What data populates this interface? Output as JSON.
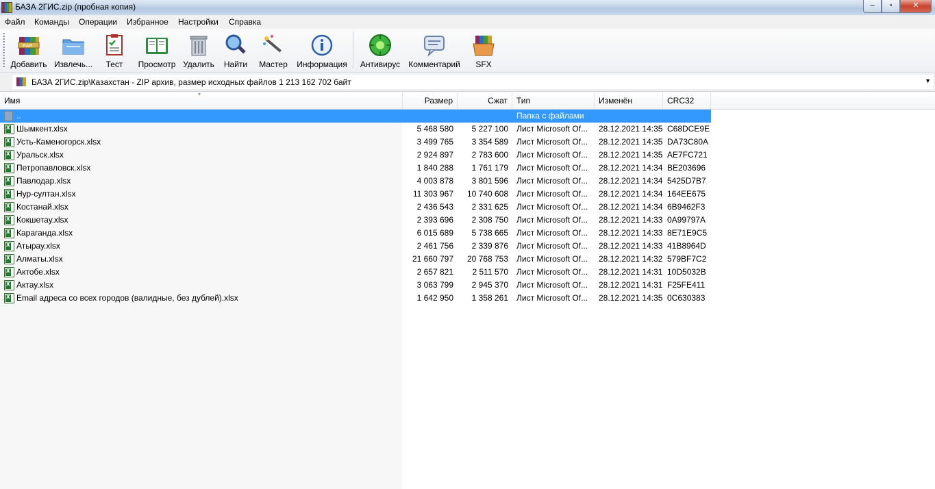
{
  "window": {
    "title": "БАЗА 2ГИС.zip (пробная копия)",
    "controls": {
      "minimize": "–",
      "maximize": "▫",
      "close": "✕"
    }
  },
  "menu": [
    {
      "label": "Файл"
    },
    {
      "label": "Команды"
    },
    {
      "label": "Операции"
    },
    {
      "label": "Избранное"
    },
    {
      "label": "Настройки"
    },
    {
      "label": "Справка"
    }
  ],
  "toolbar": [
    {
      "label": "Добавить",
      "icon": "add-archive-icon"
    },
    {
      "label": "Извлечь...",
      "icon": "extract-folder-icon"
    },
    {
      "label": "Тест",
      "icon": "test-clipboard-icon"
    },
    {
      "label": "Просмотр",
      "icon": "view-book-icon"
    },
    {
      "label": "Удалить",
      "icon": "trash-icon"
    },
    {
      "label": "Найти",
      "icon": "find-magnifier-icon"
    },
    {
      "label": "Мастер",
      "icon": "wizard-wand-icon"
    },
    {
      "label": "Информация",
      "icon": "info-icon"
    },
    {
      "label": "Антивирус",
      "icon": "antivirus-icon"
    },
    {
      "label": "Комментарий",
      "icon": "comment-icon"
    },
    {
      "label": "SFX",
      "icon": "sfx-box-icon"
    }
  ],
  "address": {
    "path": "БАЗА 2ГИС.zip\\Казахстан - ZIP архив, размер исходных файлов 1 213 162 702 байт",
    "dropdown": "▼"
  },
  "columns": {
    "name": "Имя",
    "size": "Размер",
    "packed": "Сжат",
    "type": "Тип",
    "modified": "Изменён",
    "crc": "CRC32"
  },
  "parent_row": {
    "name": "..",
    "type": "Папка с файлами"
  },
  "files": [
    {
      "name": "Шымкент.xlsx",
      "size": "5 468 580",
      "packed": "5 227 100",
      "type": "Лист Microsoft Of...",
      "modified": "28.12.2021 14:35",
      "crc": "C68DCE9E"
    },
    {
      "name": "Усть-Каменогорск.xlsx",
      "size": "3 499 765",
      "packed": "3 354 589",
      "type": "Лист Microsoft Of...",
      "modified": "28.12.2021 14:35",
      "crc": "DA73C80A"
    },
    {
      "name": "Уральск.xlsx",
      "size": "2 924 897",
      "packed": "2 783 600",
      "type": "Лист Microsoft Of...",
      "modified": "28.12.2021 14:35",
      "crc": "AE7FC721"
    },
    {
      "name": "Петропавловск.xlsx",
      "size": "1 840 288",
      "packed": "1 761 179",
      "type": "Лист Microsoft Of...",
      "modified": "28.12.2021 14:34",
      "crc": "BE203696"
    },
    {
      "name": "Павлодар.xlsx",
      "size": "4 003 878",
      "packed": "3 801 596",
      "type": "Лист Microsoft Of...",
      "modified": "28.12.2021 14:34",
      "crc": "5425D7B7"
    },
    {
      "name": "Нур-султан.xlsx",
      "size": "11 303 967",
      "packed": "10 740 608",
      "type": "Лист Microsoft Of...",
      "modified": "28.12.2021 14:34",
      "crc": "164EE675"
    },
    {
      "name": "Костанай.xlsx",
      "size": "2 436 543",
      "packed": "2 331 625",
      "type": "Лист Microsoft Of...",
      "modified": "28.12.2021 14:34",
      "crc": "6B9462F3"
    },
    {
      "name": "Кокшетау.xlsx",
      "size": "2 393 696",
      "packed": "2 308 750",
      "type": "Лист Microsoft Of...",
      "modified": "28.12.2021 14:33",
      "crc": "0A99797A"
    },
    {
      "name": "Караганда.xlsx",
      "size": "6 015 689",
      "packed": "5 738 665",
      "type": "Лист Microsoft Of...",
      "modified": "28.12.2021 14:33",
      "crc": "8E71E9C5"
    },
    {
      "name": "Атырау.xlsx",
      "size": "2 461 756",
      "packed": "2 339 876",
      "type": "Лист Microsoft Of...",
      "modified": "28.12.2021 14:33",
      "crc": "41B8964D"
    },
    {
      "name": "Алматы.xlsx",
      "size": "21 660 797",
      "packed": "20 768 753",
      "type": "Лист Microsoft Of...",
      "modified": "28.12.2021 14:32",
      "crc": "579BF7C2"
    },
    {
      "name": "Актобе.xlsx",
      "size": "2 657 821",
      "packed": "2 511 570",
      "type": "Лист Microsoft Of...",
      "modified": "28.12.2021 14:31",
      "crc": "10D5032B"
    },
    {
      "name": "Актау.xlsx",
      "size": "3 063 799",
      "packed": "2 945 370",
      "type": "Лист Microsoft Of...",
      "modified": "28.12.2021 14:31",
      "crc": "F25FE411"
    },
    {
      "name": "Email адреса со всех городов (валидные, без дублей).xlsx",
      "size": "1 642 950",
      "packed": "1 358 261",
      "type": "Лист Microsoft Of...",
      "modified": "28.12.2021 14:35",
      "crc": "0C630383"
    }
  ]
}
